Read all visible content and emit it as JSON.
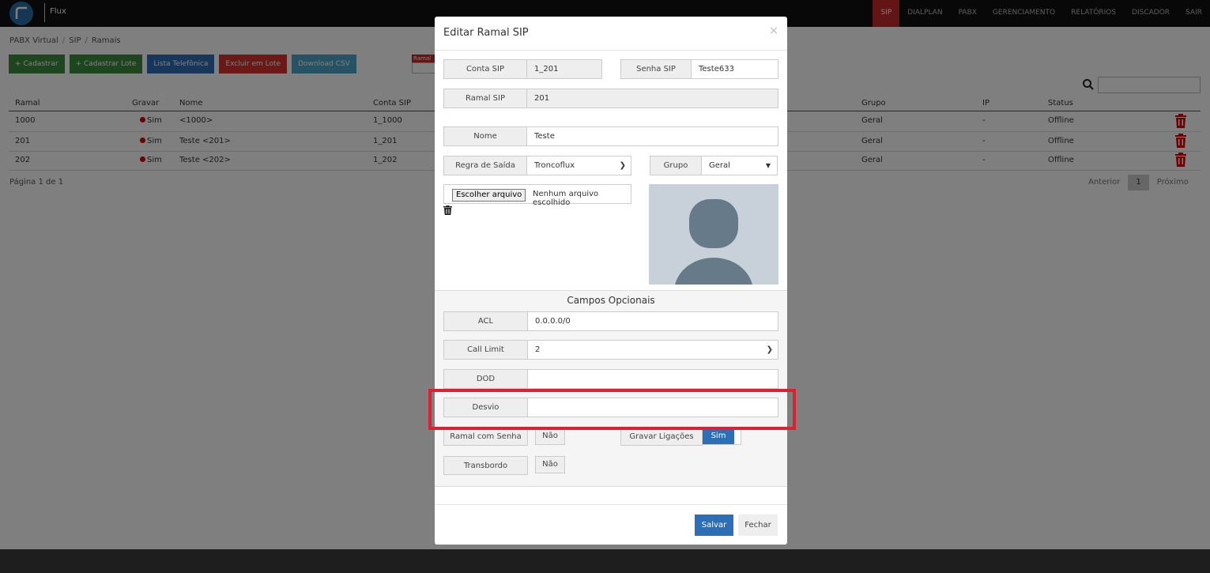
{
  "brand": "Flux",
  "nav": [
    "SIP",
    "DIALPLAN",
    "PABX",
    "GERENCIAMENTO",
    "RELATÓRIOS",
    "DISCADOR",
    "SAIR"
  ],
  "breadcrumb": [
    "PABX Virtual",
    "SIP",
    "Ramais"
  ],
  "buttons": {
    "cadastrar": "+ Cadastrar",
    "cadastrar_lote": "+ Cadastrar Lote",
    "lista": "Lista Telefônica",
    "excluir": "Excluir em Lote",
    "download": "Download CSV"
  },
  "ramal_badge": "Ramal",
  "table": {
    "headers": [
      "Ramal",
      "Gravar",
      "Nome",
      "Conta SIP",
      "Grupo",
      "IP",
      "Status"
    ],
    "rows": [
      {
        "ramal": "1000",
        "gravar": "Sim",
        "nome": "<1000>",
        "conta": "1_1000",
        "grupo": "Geral",
        "ip": "-",
        "status": "Offline"
      },
      {
        "ramal": "201",
        "gravar": "Sim",
        "nome": "Teste <201>",
        "conta": "1_201",
        "grupo": "Geral",
        "ip": "-",
        "status": "Offline"
      },
      {
        "ramal": "202",
        "gravar": "Sim",
        "nome": "Teste <202>",
        "conta": "1_202",
        "grupo": "Geral",
        "ip": "-",
        "status": "Offline"
      }
    ]
  },
  "page_info": "Página 1 de 1",
  "pager": {
    "prev": "Anterior",
    "current": "1",
    "next": "Próximo"
  },
  "modal": {
    "title": "Editar Ramal SIP",
    "close": "×",
    "conta_sip_label": "Conta SIP",
    "conta_sip_value": "1_201",
    "senha_sip_label": "Senha SIP",
    "senha_sip_value": "Teste633",
    "ramal_sip_label": "Ramal SIP",
    "ramal_sip_value": "201",
    "nome_label": "Nome",
    "nome_value": "Teste",
    "regra_label": "Regra de Saída",
    "regra_value": "Troncoflux",
    "grupo_label": "Grupo",
    "grupo_value": "Geral",
    "file_button": "Escolher arquivo",
    "file_text": "Nenhum arquivo escolhido",
    "optional_title": "Campos Opcionais",
    "acl_label": "ACL",
    "acl_value": "0.0.0.0/0",
    "call_limit_label": "Call Limit",
    "call_limit_value": "2",
    "dod_label": "DOD",
    "dod_value": "",
    "desvio_label": "Desvio",
    "desvio_value": "",
    "ramal_senha_label": "Ramal com Senha",
    "ramal_senha_value": "Não",
    "gravar_label": "Gravar Ligações",
    "gravar_value": "Sim",
    "transbordo_label": "Transbordo",
    "transbordo_value": "Não",
    "save": "Salvar",
    "fechar": "Fechar"
  },
  "colors": {
    "accent": "#c62828",
    "primary": "#2d6fb6",
    "highlight": "#e02030"
  }
}
